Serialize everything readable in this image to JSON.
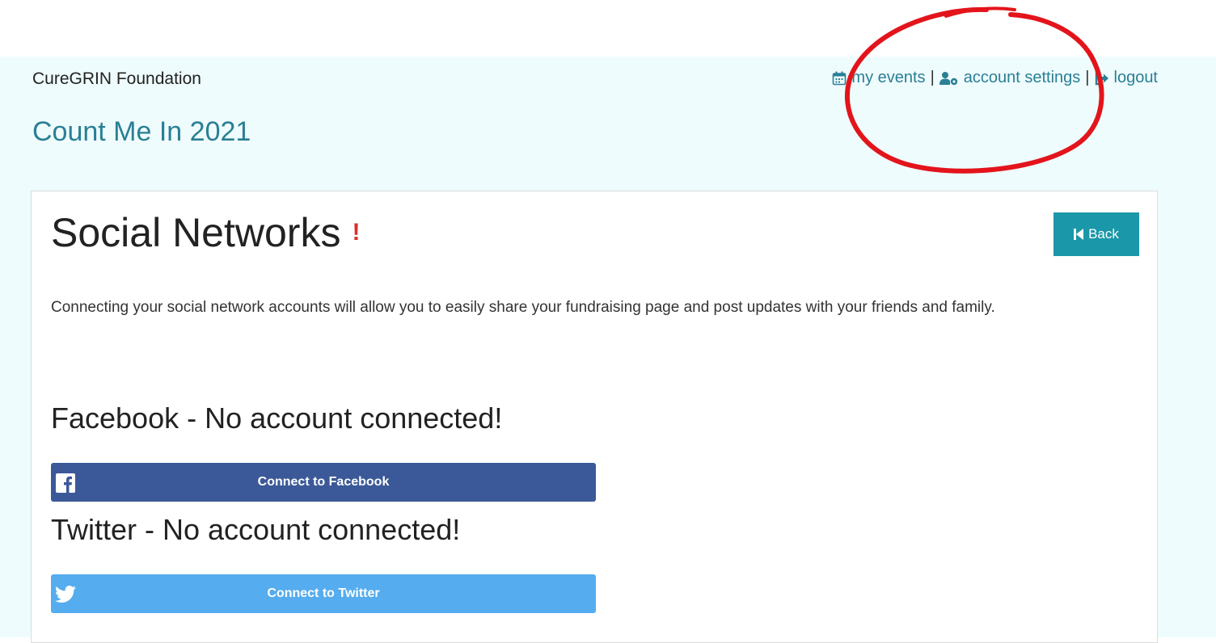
{
  "header": {
    "org_name": "CureGRIN Foundation",
    "event_title": "Count Me In 2021",
    "nav": {
      "my_events": "my events",
      "separator": "|",
      "account_settings": "account settings",
      "logout": "logout"
    }
  },
  "card": {
    "title": "Social Networks",
    "warning_mark": "!",
    "back_label": "Back",
    "intro": "Connecting your social network accounts will allow you to easily share your fundraising page and post updates with your friends and family."
  },
  "facebook": {
    "heading": "Facebook - No account connected!",
    "button_label": "Connect to Facebook"
  },
  "twitter": {
    "heading": "Twitter - No account connected!",
    "button_label": "Connect to Twitter"
  },
  "colors": {
    "page_bg": "#effcfd",
    "accent": "#2a7f95",
    "back_button": "#1a97a8",
    "facebook": "#3b5998",
    "twitter": "#55acee",
    "warning": "#d9302c",
    "annotation": "#e3141b"
  },
  "icons": {
    "my_events": "calendar-icon",
    "account_settings": "user-gear-icon",
    "logout": "sign-out-icon",
    "back": "step-backward-icon",
    "facebook": "facebook-icon",
    "twitter": "twitter-icon"
  }
}
